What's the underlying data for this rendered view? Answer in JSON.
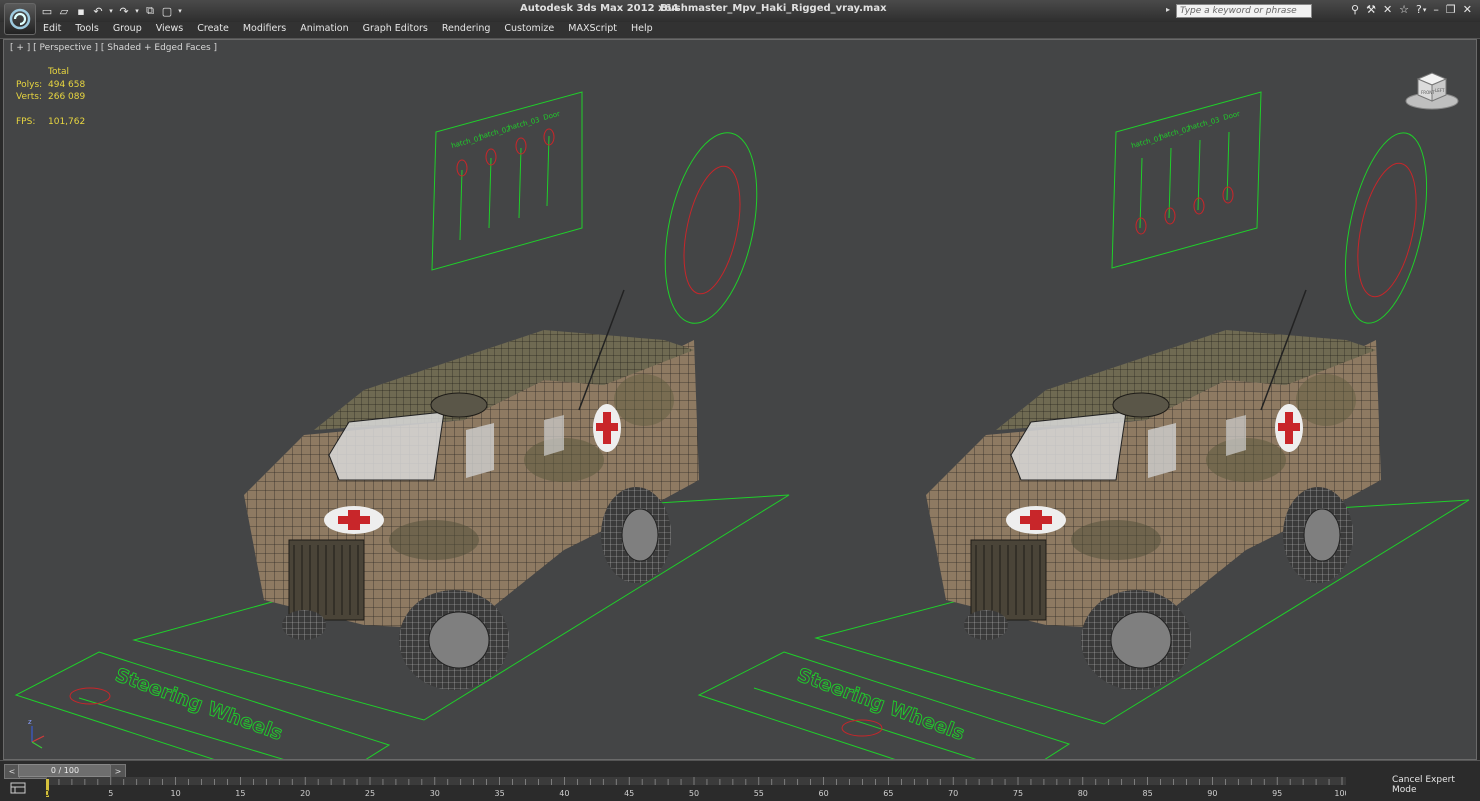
{
  "app": {
    "title": "Autodesk 3ds Max  2012 x64",
    "file": "Bushmaster_Mpv_Haki_Rigged_vray.max"
  },
  "search": {
    "placeholder": "Type a keyword or phrase"
  },
  "menu": [
    "Edit",
    "Tools",
    "Group",
    "Views",
    "Create",
    "Modifiers",
    "Animation",
    "Graph Editors",
    "Rendering",
    "Customize",
    "MAXScript",
    "Help"
  ],
  "viewport": {
    "label": "[ + ] [ Perspective ] [ Shaded + Edged Faces ]",
    "stats": {
      "total_label": "Total",
      "polys_label": "Polys:",
      "polys_value": "494 658",
      "verts_label": "Verts:",
      "verts_value": "266 089",
      "fps_label": "FPS:",
      "fps_value": "101,762"
    },
    "rig_labels": {
      "hatch_01": "hatch_01",
      "hatch_02": "hatch_02",
      "hatch_03": "hatch_03",
      "door": "Door",
      "steering": "Steering Wheels"
    },
    "viewcube": {
      "face_label": "FRONT",
      "side_label": "LEFT"
    }
  },
  "timeline": {
    "frame_display": "0 / 100",
    "prev_glyph": "<",
    "next_glyph": ">",
    "ticks": [
      "0",
      "5",
      "10",
      "15",
      "20",
      "25",
      "30",
      "35",
      "40",
      "45",
      "50",
      "55",
      "60",
      "65",
      "70",
      "75",
      "80",
      "85",
      "90",
      "95",
      "100"
    ],
    "cancel_label": "Cancel Expert Mode"
  },
  "colors": {
    "viewport_bg": "#444546",
    "helper_green": "#1fcf2a",
    "helper_red": "#c8262a",
    "stats_yellow": "#e8d640"
  },
  "icons": [
    "3ds-max-logo-icon",
    "new-file-icon",
    "open-file-icon",
    "save-icon",
    "undo-icon",
    "redo-icon",
    "project-icon",
    "maximize-icon",
    "dropdown-icon",
    "binoculars-icon",
    "tools-icon",
    "subscription-icon",
    "favorites-icon",
    "help-icon",
    "minimize-icon",
    "restore-icon",
    "close-icon",
    "axis-tripod-icon",
    "trackbar-icon"
  ]
}
